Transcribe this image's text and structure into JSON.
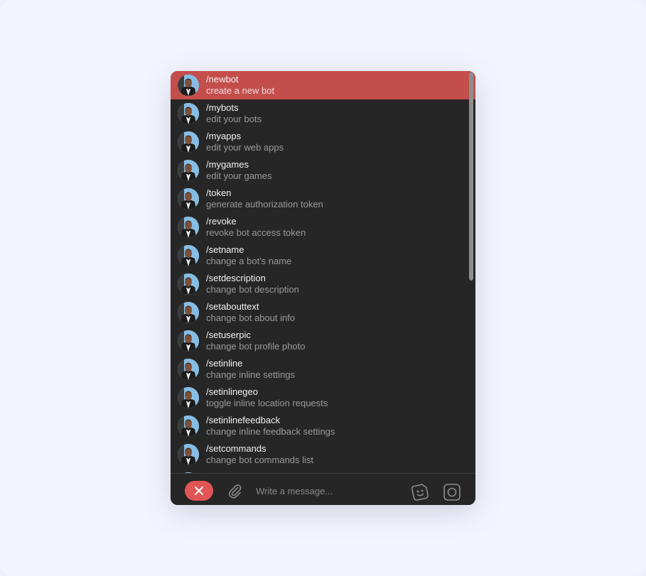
{
  "commands": [
    {
      "command": "/newbot",
      "description": "create a new bot",
      "selected": true
    },
    {
      "command": "/mybots",
      "description": "edit your bots"
    },
    {
      "command": "/myapps",
      "description": "edit your web apps"
    },
    {
      "command": "/mygames",
      "description": "edit your games"
    },
    {
      "command": "/token",
      "description": "generate authorization token"
    },
    {
      "command": "/revoke",
      "description": "revoke bot access token"
    },
    {
      "command": "/setname",
      "description": "change a bot's name"
    },
    {
      "command": "/setdescription",
      "description": "change bot description"
    },
    {
      "command": "/setabouttext",
      "description": "change bot about info"
    },
    {
      "command": "/setuserpic",
      "description": "change bot profile photo"
    },
    {
      "command": "/setinline",
      "description": "change inline settings"
    },
    {
      "command": "/setinlinegeo",
      "description": "toggle inline location requests"
    },
    {
      "command": "/setinlinefeedback",
      "description": "change inline feedback settings"
    },
    {
      "command": "/setcommands",
      "description": "change bot commands list"
    }
  ],
  "composer": {
    "placeholder": "Write a message...",
    "value": ""
  },
  "icons": {
    "cancel": "close-icon",
    "attach": "paperclip-icon",
    "sticker": "sticker-icon",
    "camera": "camera-icon"
  },
  "colors": {
    "selected_row": "#c44e4c",
    "panel_bg": "#262626",
    "cancel_button": "#e25555"
  }
}
